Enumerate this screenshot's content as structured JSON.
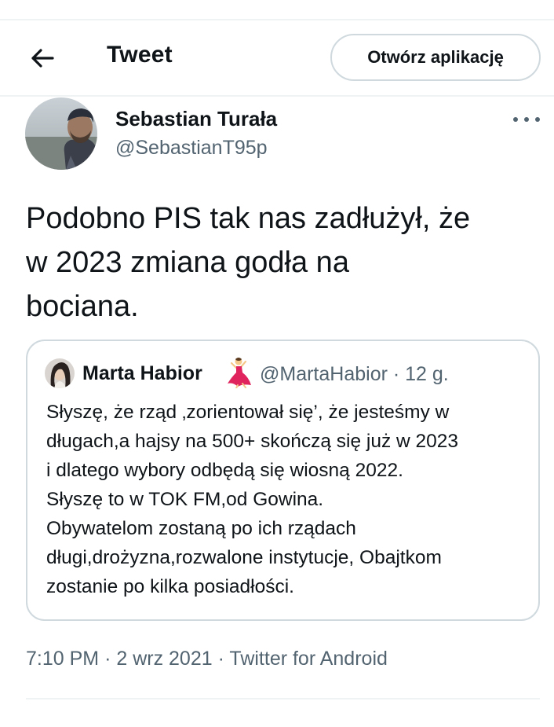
{
  "header": {
    "title": "Tweet",
    "open_app_label": "Otwórz aplikację"
  },
  "tweet": {
    "author_name": "Sebastian Turała",
    "author_handle": "@SebastianT95p",
    "text": "Podobno PIS tak nas zadłużył, że\nw 2023 zmiana godła na\nbociana.",
    "time": "7:10 PM",
    "date": "2 wrz 2021",
    "source": "Twitter for Android",
    "separator": "·"
  },
  "quote": {
    "author_name": "Marta Habior",
    "author_handle": "@MartaHabior · 12 g.",
    "emoji_icon": "dancer-emoji-icon",
    "text": "Słyszę, że rząd ‚zorientował się’, że jesteśmy w\ndługach,a hajsy na 500+ skończą się już w 2023\ni dlatego wybory odbędą się wiosną 2022.\nSłyszę to w TOK FM,od Gowina.\nObywatelom zostaną po ich rządach\ndługi,drożyzna,rozwalone instytucje, Obajtkom\nzostanie po kilka posiadłości."
  },
  "colors": {
    "text_primary": "#0f1419",
    "text_secondary": "#536471",
    "border": "#cfd9de",
    "divider": "#eff3f4"
  }
}
